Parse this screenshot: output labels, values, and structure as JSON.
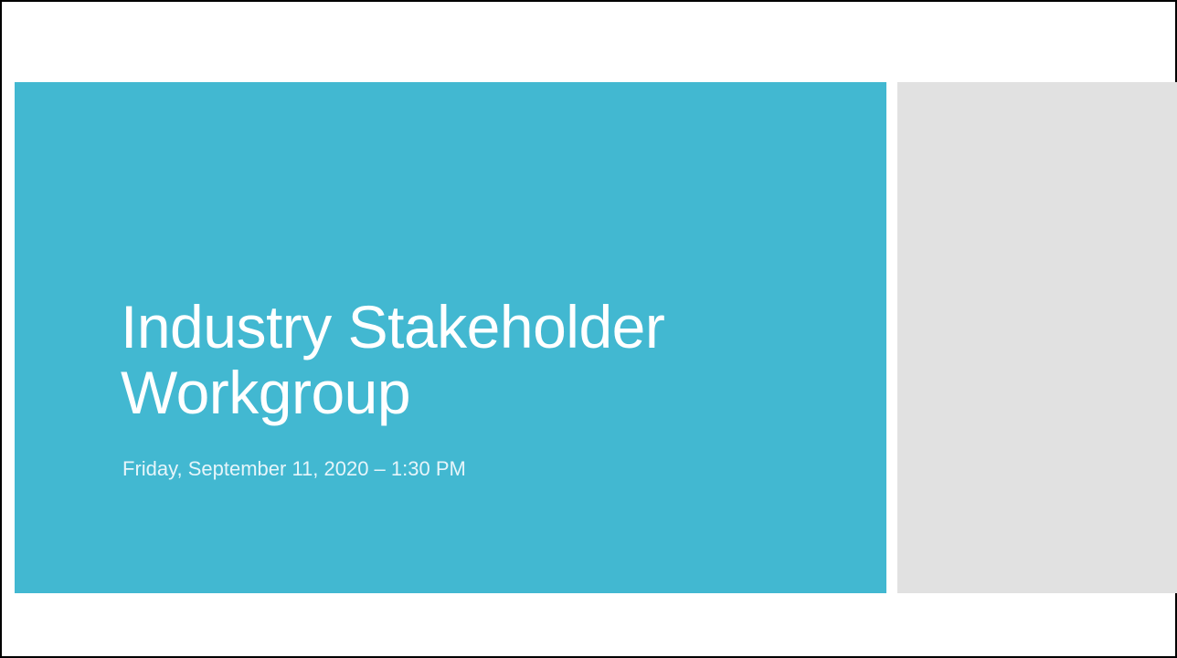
{
  "slide": {
    "title": "Industry Stakeholder Workgroup",
    "subtitle": "Friday, September 11, 2020 – 1:30 PM"
  },
  "colors": {
    "title_panel": "#42B8D1",
    "side_panel": "#E1E1E1",
    "border": "#000000"
  }
}
